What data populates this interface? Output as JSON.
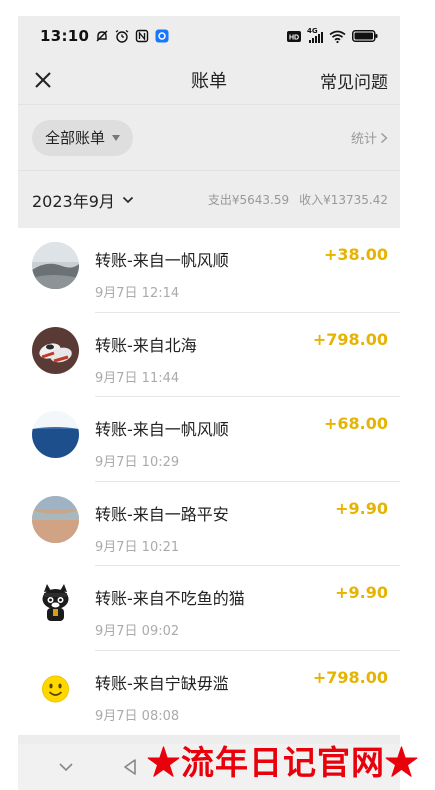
{
  "status_bar": {
    "time": "13:10",
    "left_icons": [
      "mute-icon",
      "alarm-icon",
      "nfc-icon",
      "app-notification-icon"
    ],
    "right_icons": [
      "hd-icon",
      "signal-4g-icon",
      "wifi-icon",
      "battery-icon"
    ],
    "network_label": "4G"
  },
  "header": {
    "title": "账单",
    "faq_label": "常见问题"
  },
  "filter": {
    "label": "全部账单",
    "stats_label": "统计"
  },
  "month_bar": {
    "month": "2023年9月",
    "expense": "支出¥5643.59",
    "income": "收入¥13735.42"
  },
  "transactions": [
    {
      "title": "转账-来自一帆风顺",
      "time": "9月7日 12:14",
      "amount": "+38.00",
      "avatar": "landscape-photo"
    },
    {
      "title": "转账-来自北海",
      "time": "9月7日 11:44",
      "amount": "+798.00",
      "avatar": "shoes-photo"
    },
    {
      "title": "转账-来自一帆风顺",
      "time": "9月7日 10:29",
      "amount": "+68.00",
      "avatar": "sea-photo"
    },
    {
      "title": "转账-来自一路平安",
      "time": "9月7日 10:21",
      "amount": "+9.90",
      "avatar": "beach-photo"
    },
    {
      "title": "转账-来自不吃鱼的猫",
      "time": "9月7日 09:02",
      "amount": "+9.90",
      "avatar": "cartoon-cat"
    },
    {
      "title": "转账-来自宁缺毋滥",
      "time": "9月7日 08:08",
      "amount": "+798.00",
      "avatar": "smiley-face"
    }
  ],
  "watermark": "★流年日记官网★",
  "colors": {
    "amount": "#e6b400",
    "background": "#ededed",
    "watermark": "#e8000b"
  }
}
